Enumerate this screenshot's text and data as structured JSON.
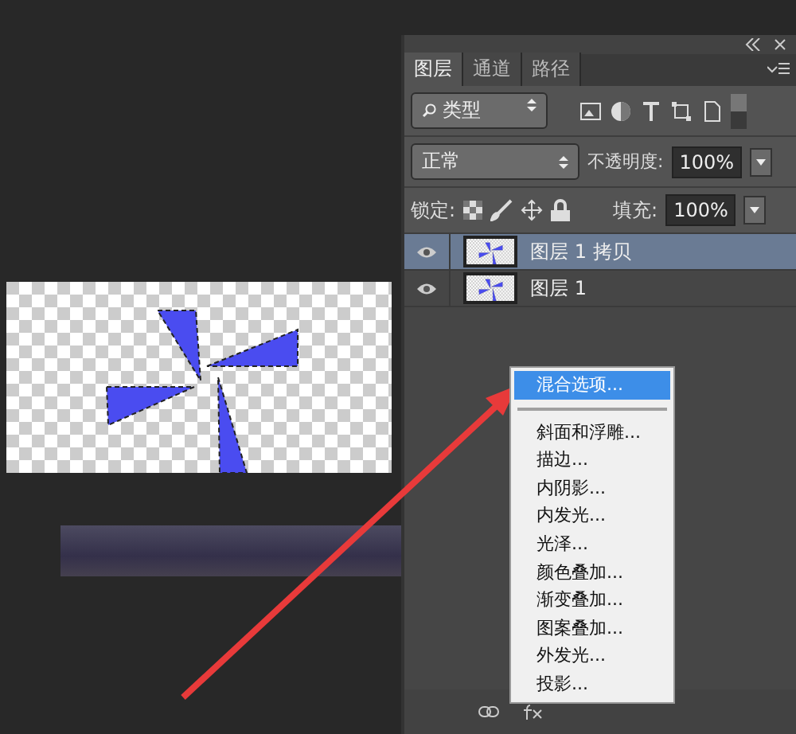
{
  "layers_panel": {
    "tabs": [
      {
        "label": "图层",
        "selected": true
      },
      {
        "label": "通道",
        "selected": false
      },
      {
        "label": "路径",
        "selected": false
      }
    ],
    "filter": {
      "value": "类型"
    },
    "blend_mode": "正常",
    "opacity_label": "不透明度:",
    "opacity": "100%",
    "lock_label": "锁定:",
    "fill_label": "填充:",
    "fill": "100%",
    "layers": [
      {
        "name": "图层 1 拷贝",
        "selected": true,
        "visible": true
      },
      {
        "name": "图层 1",
        "selected": false,
        "visible": true
      }
    ]
  },
  "context_menu": {
    "items": [
      {
        "kind": "item",
        "label": "混合选项...",
        "selected": true
      },
      {
        "kind": "separator"
      },
      {
        "kind": "item",
        "label": "斜面和浮雕...",
        "selected": false
      },
      {
        "kind": "item",
        "label": "描边...",
        "selected": false
      },
      {
        "kind": "item",
        "label": "内阴影...",
        "selected": false
      },
      {
        "kind": "item",
        "label": "内发光...",
        "selected": false
      },
      {
        "kind": "item",
        "label": "光泽...",
        "selected": false
      },
      {
        "kind": "item",
        "label": "颜色叠加...",
        "selected": false
      },
      {
        "kind": "item",
        "label": "渐变叠加...",
        "selected": false
      },
      {
        "kind": "item",
        "label": "图案叠加...",
        "selected": false
      },
      {
        "kind": "item",
        "label": "外发光...",
        "selected": false
      },
      {
        "kind": "item",
        "label": "投影...",
        "selected": false
      }
    ]
  }
}
